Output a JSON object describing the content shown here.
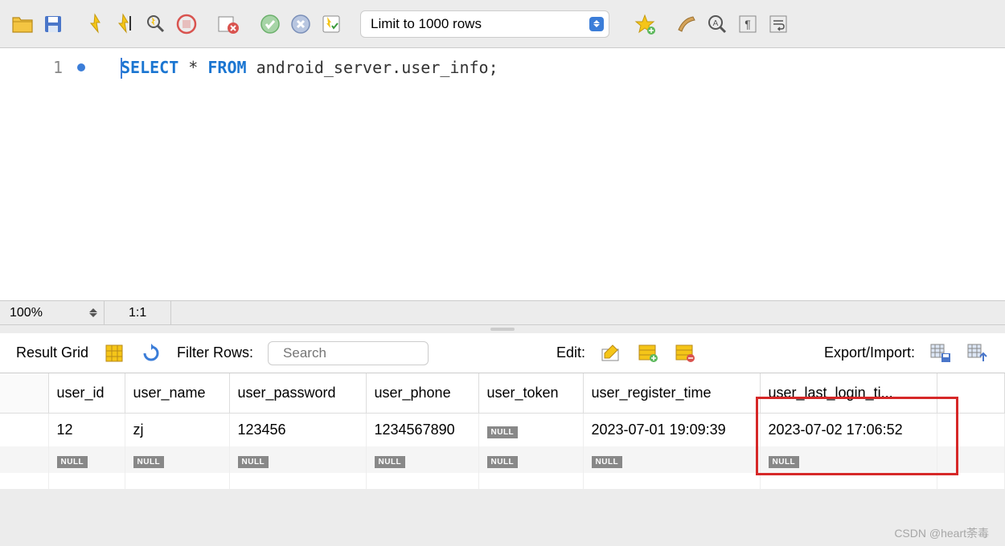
{
  "toolbar": {
    "limit_label": "Limit to 1000 rows"
  },
  "editor": {
    "line_number": "1",
    "sql_kw1": "SELECT",
    "sql_star": " * ",
    "sql_kw2": "FROM",
    "sql_rest": " android_server.user_info;"
  },
  "status": {
    "zoom": "100%",
    "position": "1:1"
  },
  "result_toolbar": {
    "title": "Result Grid",
    "filter_label": "Filter Rows:",
    "search_placeholder": "Search",
    "edit_label": "Edit:",
    "export_label": "Export/Import:"
  },
  "columns": [
    "user_id",
    "user_name",
    "user_password",
    "user_phone",
    "user_token",
    "user_register_time",
    "user_last_login_ti..."
  ],
  "rows": [
    {
      "user_id": "12",
      "user_name": "zj",
      "user_password": "123456",
      "user_phone": "1234567890",
      "user_token": null,
      "user_register_time": "2023-07-01 19:09:39",
      "user_last_login_time": "2023-07-02 17:06:52"
    }
  ],
  "null_label": "NULL",
  "watermark": "CSDN @heart荼毒"
}
